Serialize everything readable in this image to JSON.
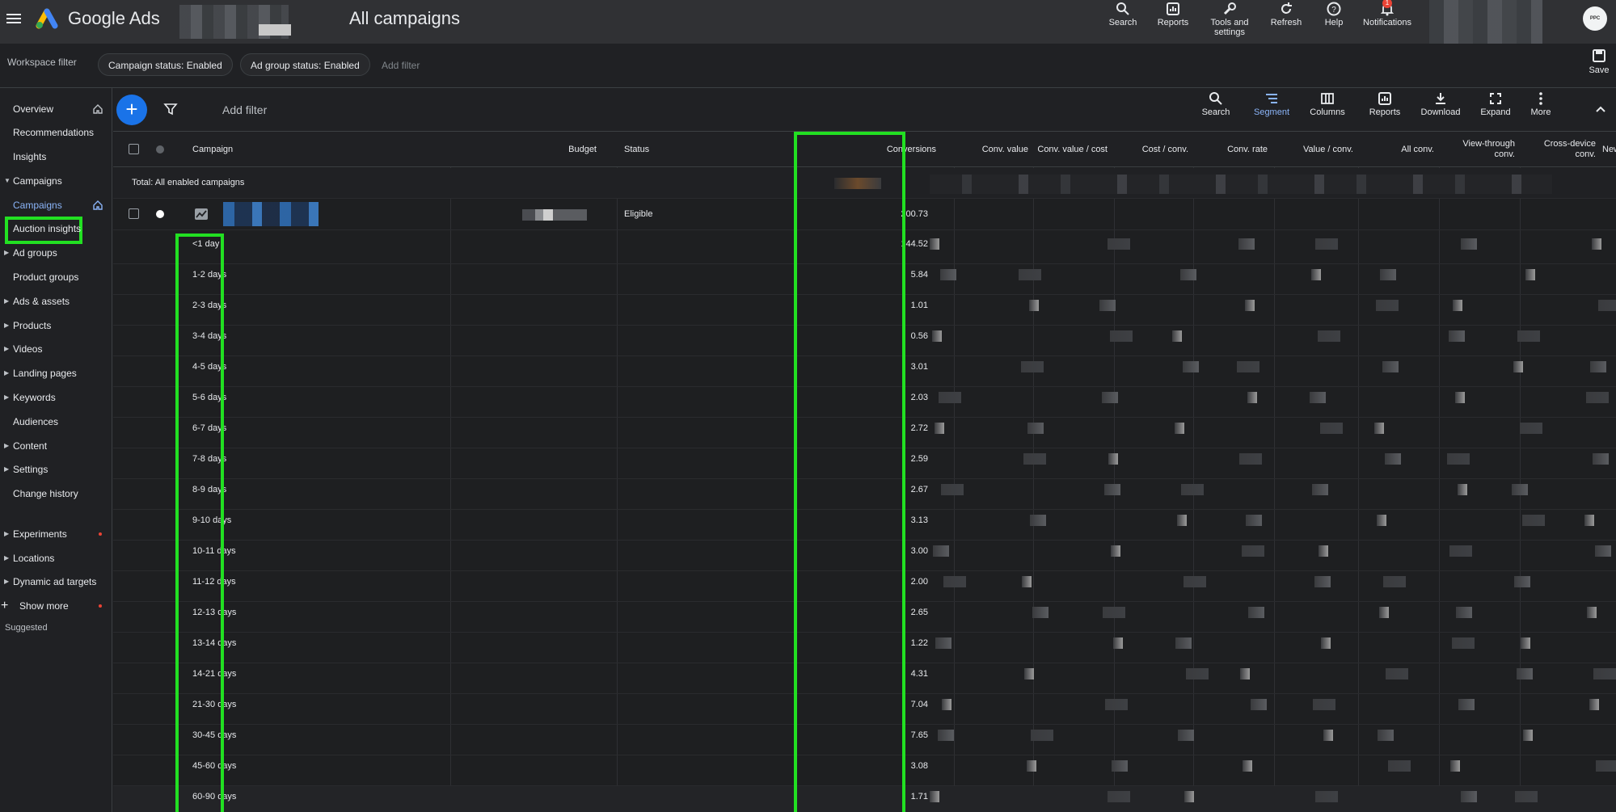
{
  "app": {
    "product_name": "Google Ads",
    "page_title": "All campaigns"
  },
  "top_actions": [
    {
      "label": "Search",
      "icon": "search-icon"
    },
    {
      "label": "Reports",
      "icon": "reports-icon"
    },
    {
      "label": "Tools and settings",
      "icon": "wrench-icon"
    },
    {
      "label": "Refresh",
      "icon": "refresh-icon"
    },
    {
      "label": "Help",
      "icon": "help-icon"
    },
    {
      "label": "Notifications",
      "icon": "bell-icon",
      "badge": "1"
    }
  ],
  "avatar_text": "PPC",
  "filter_bar": {
    "workspace_label": "Workspace filter",
    "chips": [
      "Campaign status: Enabled",
      "Ad group status: Enabled"
    ],
    "add_filter": "Add filter",
    "save_label": "Save"
  },
  "sidebar": {
    "items": [
      {
        "label": "Overview",
        "home": true
      },
      {
        "label": "Recommendations"
      },
      {
        "label": "Insights"
      },
      {
        "label": "Campaigns",
        "caret": "down"
      },
      {
        "label": "Campaigns",
        "active": true,
        "home": true
      },
      {
        "label": "Auction insights"
      },
      {
        "label": "Ad groups",
        "caret": "right"
      },
      {
        "label": "Product groups"
      },
      {
        "label": "Ads & assets",
        "caret": "right"
      },
      {
        "label": "Products",
        "caret": "right"
      },
      {
        "label": "Videos",
        "caret": "right"
      },
      {
        "label": "Landing pages",
        "caret": "right"
      },
      {
        "label": "Keywords",
        "caret": "right"
      },
      {
        "label": "Audiences"
      },
      {
        "label": "Content",
        "caret": "right"
      },
      {
        "label": "Settings",
        "caret": "right"
      },
      {
        "label": "Change history"
      }
    ],
    "suggested_label": "Suggested",
    "suggested": [
      {
        "label": "Experiments",
        "caret": "right",
        "dot": true
      },
      {
        "label": "Locations",
        "caret": "right"
      },
      {
        "label": "Dynamic ad targets",
        "caret": "right"
      }
    ],
    "show_more": "Show more"
  },
  "toolbar": {
    "add_filter": "Add filter",
    "tools": [
      {
        "label": "Search",
        "icon": "search-icon"
      },
      {
        "label": "Segment",
        "icon": "segment-icon",
        "active": true
      },
      {
        "label": "Columns",
        "icon": "columns-icon"
      },
      {
        "label": "Reports",
        "icon": "reports-icon"
      },
      {
        "label": "Download",
        "icon": "download-icon"
      },
      {
        "label": "Expand",
        "icon": "expand-icon"
      },
      {
        "label": "More",
        "icon": "more-icon"
      }
    ]
  },
  "table": {
    "headers": {
      "campaign": "Campaign",
      "budget": "Budget",
      "status": "Status",
      "conversions": "Conversions",
      "conv_value": "Conv. value",
      "conv_value_cost": "Conv. value / cost",
      "cost_conv": "Cost / conv.",
      "conv_rate": "Conv. rate",
      "value_conv": "Value / conv.",
      "all_conv": "All conv.",
      "view_through": "View-through conv.",
      "cross_device": "Cross-device conv.",
      "new_customers": "New customers"
    },
    "total_label": "Total: All enabled campaigns",
    "campaign_row": {
      "status": "Eligible",
      "conversions": "200.73"
    },
    "segments": [
      {
        "label": "<1 day",
        "conversions": "144.52"
      },
      {
        "label": "1-2 days",
        "conversions": "5.84"
      },
      {
        "label": "2-3 days",
        "conversions": "1.01"
      },
      {
        "label": "3-4 days",
        "conversions": "0.56"
      },
      {
        "label": "4-5 days",
        "conversions": "3.01"
      },
      {
        "label": "5-6 days",
        "conversions": "2.03"
      },
      {
        "label": "6-7 days",
        "conversions": "2.72"
      },
      {
        "label": "7-8 days",
        "conversions": "2.59"
      },
      {
        "label": "8-9 days",
        "conversions": "2.67"
      },
      {
        "label": "9-10 days",
        "conversions": "3.13"
      },
      {
        "label": "10-11 days",
        "conversions": "3.00"
      },
      {
        "label": "11-12 days",
        "conversions": "2.00"
      },
      {
        "label": "12-13 days",
        "conversions": "2.65"
      },
      {
        "label": "13-14 days",
        "conversions": "1.22"
      },
      {
        "label": "14-21 days",
        "conversions": "4.31"
      },
      {
        "label": "21-30 days",
        "conversions": "7.04"
      },
      {
        "label": "30-45 days",
        "conversions": "7.65"
      },
      {
        "label": "45-60 days",
        "conversions": "3.08"
      },
      {
        "label": "60-90 days",
        "conversions": "1.71"
      }
    ]
  },
  "colors": {
    "highlight": "#22e022",
    "accent": "#8ab4f8",
    "fab": "#1a73e8"
  }
}
